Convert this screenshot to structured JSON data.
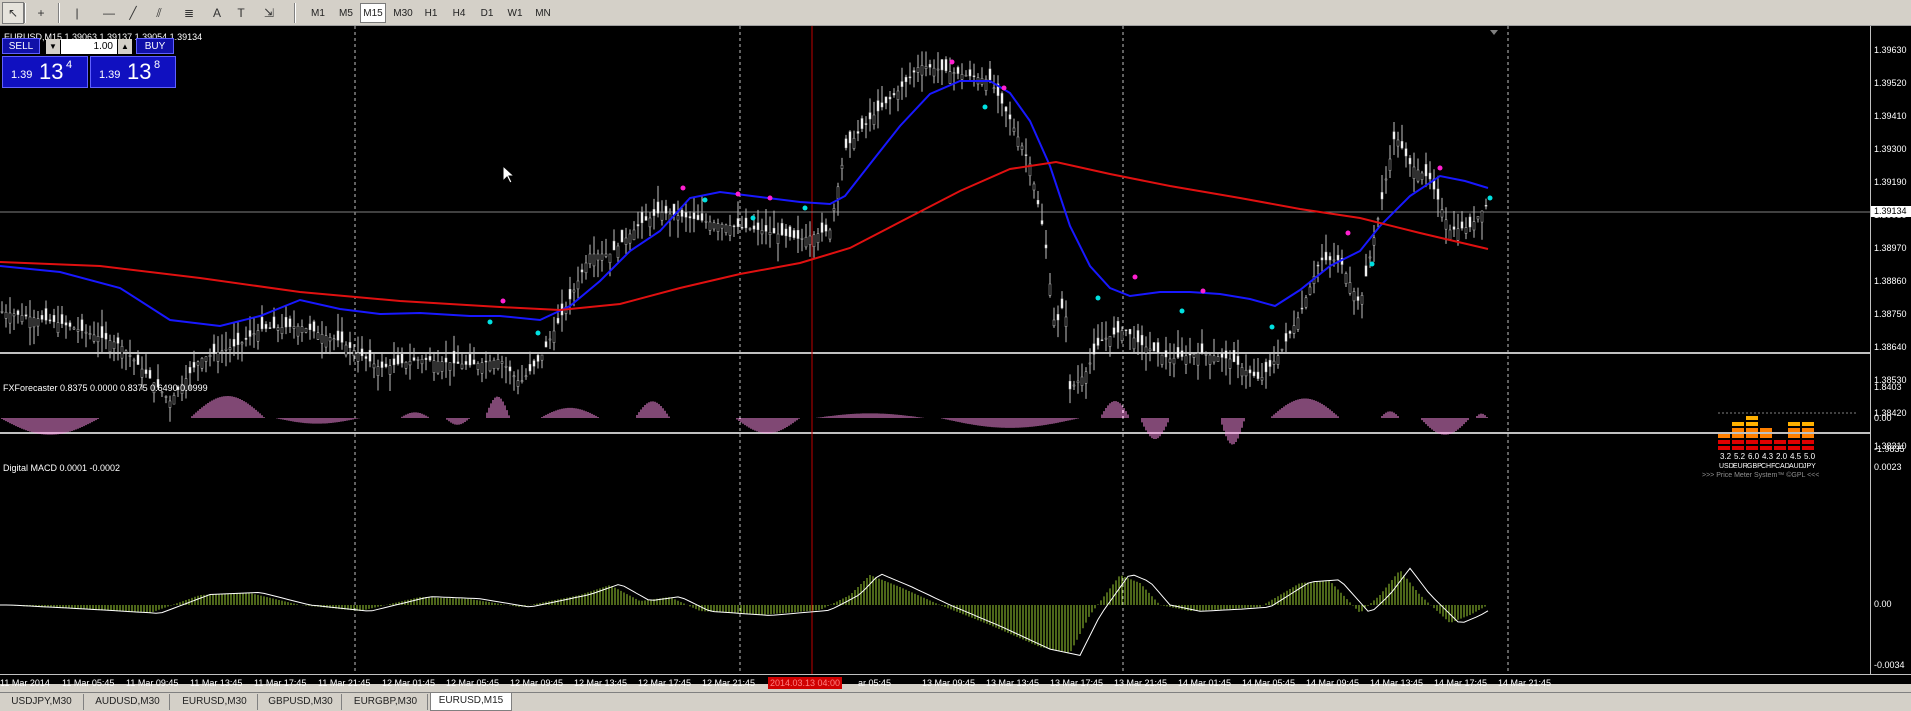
{
  "toolbar": {
    "tools": [
      {
        "name": "cursor-icon",
        "glyph": "↖"
      },
      {
        "name": "crosshair-icon",
        "glyph": "+"
      },
      {
        "name": "vertical-line-icon",
        "glyph": "|"
      },
      {
        "name": "horizontal-line-icon",
        "glyph": "—"
      },
      {
        "name": "trendline-icon",
        "glyph": "╱"
      },
      {
        "name": "channel-icon",
        "glyph": "⫽"
      },
      {
        "name": "fibonacci-icon",
        "glyph": "≣"
      },
      {
        "name": "text-icon",
        "glyph": "A"
      },
      {
        "name": "text-label-icon",
        "glyph": "T"
      },
      {
        "name": "arrows-icon",
        "glyph": "⇲"
      }
    ],
    "timeframes": [
      "M1",
      "M5",
      "M15",
      "M30",
      "H1",
      "H4",
      "D1",
      "W1",
      "MN"
    ],
    "active_timeframe": "M15"
  },
  "main_pane": {
    "title": "EURUSD,M15  1.39063 1.39137 1.39054 1.39134",
    "price_axis": [
      "1.39630",
      "1.39520",
      "1.39410",
      "1.39300",
      "1.39190",
      "1.39080",
      "1.38970",
      "1.38860",
      "1.38750",
      "1.38640",
      "1.38530",
      "1.38420",
      "1.38310"
    ],
    "current_price": "1.39134",
    "colors": {
      "candles": "#c0c0c0",
      "fast_ma": "#1818ff",
      "slow_ma": "#e01010",
      "buy_dot": "#00e0e0",
      "sell_dot": "#ff20d0"
    }
  },
  "one_click": {
    "sell_label": "SELL",
    "buy_label": "BUY",
    "lot": "1.00",
    "sell_prefix": "1.39",
    "sell_big": "13",
    "sell_sup": "4",
    "buy_prefix": "1.39",
    "buy_big": "13",
    "buy_sup": "8"
  },
  "price_meter": {
    "values": [
      "3.2",
      "5.2",
      "6.0",
      "4.3",
      "2.0",
      "4.5",
      "5.0"
    ],
    "currencies": [
      "USD",
      "EUR",
      "GBP",
      "CHF",
      "CAD",
      "AUD",
      "JPY"
    ],
    "caption": ">>> Price Meter System™ ©GPL <<<"
  },
  "forecaster_pane": {
    "title": "FXForecaster 0.8375 0.0000 0.8375 0.6490 0.0999",
    "axis": [
      "1.8403",
      "0.00",
      "-1.9835"
    ],
    "color": "#ff90e8"
  },
  "macd_pane": {
    "title": "Digital MACD 0.0001 -0.0002",
    "axis": [
      "0.0023",
      "0.00",
      "-0.0034"
    ],
    "hist_color": "#9acd32",
    "signal_color": "#ffffff"
  },
  "time_axis": [
    "11 Mar 2014",
    "11 Mar 05:45",
    "11 Mar 09:45",
    "11 Mar 13:45",
    "11 Mar 17:45",
    "11 Mar 21:45",
    "12 Mar 01:45",
    "12 Mar 05:45",
    "12 Mar 09:45",
    "12 Mar 13:45",
    "12 Mar 17:45",
    "12 Mar 21:45",
    "ar 05:45",
    "13 Mar 09:45",
    "13 Mar 13:45",
    "13 Mar 17:45",
    "13 Mar 21:45",
    "14 Mar 01:45",
    "14 Mar 05:45",
    "14 Mar 09:45",
    "14 Mar 13:45",
    "14 Mar 17:45",
    "14 Mar 21:45"
  ],
  "time_cursor": "2014.03.13 04:00",
  "tabs": [
    "USDJPY,M30",
    "AUDUSD,M30",
    "EURUSD,M30",
    "GBPUSD,M30",
    "EURGBP,M30",
    "EURUSD,M15"
  ],
  "active_tab": "EURUSD,M15"
}
